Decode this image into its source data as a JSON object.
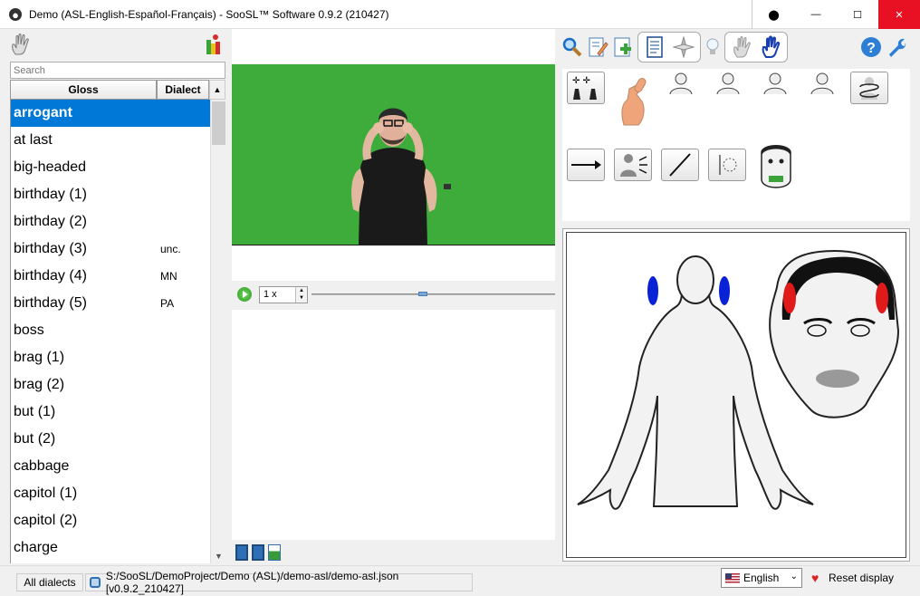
{
  "window": {
    "title": "Demo (ASL-English-Español-Français) - SooSL™ Software 0.9.2 (210427)",
    "minimize": "—",
    "maximize": "☐",
    "close": "✕",
    "custom": "⬤"
  },
  "search": {
    "placeholder": "Search"
  },
  "list": {
    "headers": {
      "gloss": "Gloss",
      "dialect": "Dialect"
    },
    "rows": [
      {
        "gloss": "arrogant",
        "dialect": "",
        "selected": true
      },
      {
        "gloss": "at last",
        "dialect": ""
      },
      {
        "gloss": "big-headed",
        "dialect": ""
      },
      {
        "gloss": "birthday (1)",
        "dialect": ""
      },
      {
        "gloss": "birthday (2)",
        "dialect": ""
      },
      {
        "gloss": "birthday (3)",
        "dialect": "unc."
      },
      {
        "gloss": "birthday (4)",
        "dialect": "MN"
      },
      {
        "gloss": "birthday (5)",
        "dialect": "PA"
      },
      {
        "gloss": "boss",
        "dialect": ""
      },
      {
        "gloss": "brag (1)",
        "dialect": ""
      },
      {
        "gloss": "brag (2)",
        "dialect": ""
      },
      {
        "gloss": "but (1)",
        "dialect": ""
      },
      {
        "gloss": "but (2)",
        "dialect": ""
      },
      {
        "gloss": "cabbage",
        "dialect": ""
      },
      {
        "gloss": "capitol (1)",
        "dialect": ""
      },
      {
        "gloss": "capitol (2)",
        "dialect": ""
      },
      {
        "gloss": "charge",
        "dialect": ""
      }
    ]
  },
  "player": {
    "speed": "1 x",
    "position": 0.44
  },
  "status": {
    "dialects": "All dialects",
    "path": "S:/SooSL/DemoProject/Demo (ASL)/demo-asl/demo-asl.json [v0.9.2_210427]",
    "language": "English",
    "reset": "Reset display"
  },
  "colors": {
    "accent": "#0078d7",
    "video_bg": "#3dac3a",
    "location_left": "#0a22d6",
    "location_right": "#e0191b"
  }
}
